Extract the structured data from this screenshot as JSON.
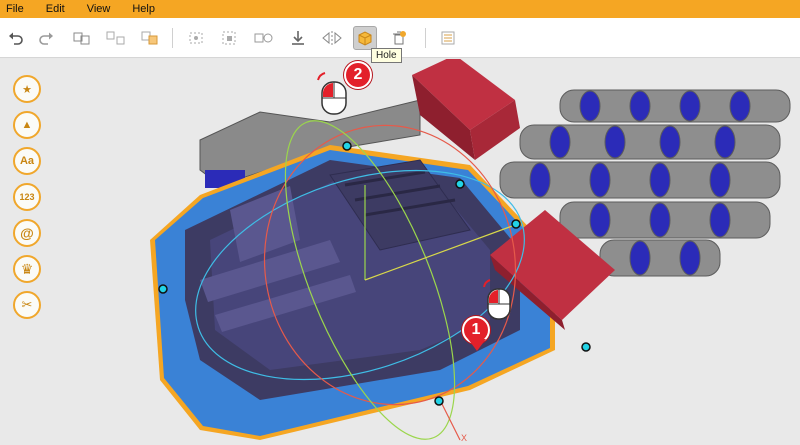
{
  "menu": {
    "file": "File",
    "edit": "Edit",
    "view": "View",
    "help": "Help"
  },
  "toolbar": {
    "tooltip": "Hole",
    "buttons": [
      {
        "name": "undo-icon"
      },
      {
        "name": "redo-icon"
      },
      {
        "name": "group-icon"
      },
      {
        "name": "ungroup-icon"
      },
      {
        "name": "add-to-group-icon"
      },
      {
        "name": "align-icon"
      },
      {
        "name": "distribute-icon"
      },
      {
        "name": "duplicate-icon"
      },
      {
        "name": "drop-to-floor-icon"
      },
      {
        "name": "mirror-icon"
      },
      {
        "name": "hole-icon"
      },
      {
        "name": "delete-hole-icon"
      },
      {
        "name": "notes-icon"
      }
    ]
  },
  "side_tools": [
    {
      "name": "favorites",
      "glyph": "★"
    },
    {
      "name": "shapes",
      "glyph": "▲"
    },
    {
      "name": "text",
      "glyph": "Aa"
    },
    {
      "name": "numbers",
      "glyph": "123"
    },
    {
      "name": "symbols",
      "glyph": "@"
    },
    {
      "name": "crown",
      "glyph": "♛"
    },
    {
      "name": "tools",
      "glyph": "✂"
    }
  ],
  "callouts": {
    "one": "1",
    "two": "2"
  },
  "axis_label": "X",
  "colors": {
    "accent": "#f5a623",
    "selection_blue": "#3a82d6",
    "dark_slate": "#3d3b63",
    "hole_red": "#b0283a",
    "chain_grey": "#8e8e8e",
    "chain_blue": "#2b2bb8",
    "callout_red": "#e3202a"
  }
}
